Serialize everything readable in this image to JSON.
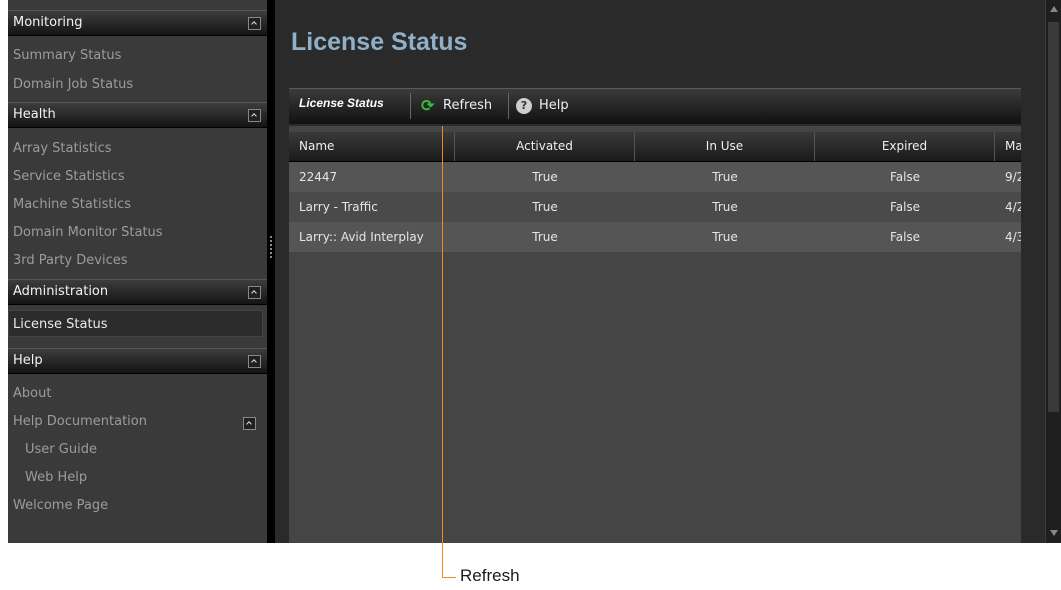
{
  "sidebar": {
    "sections": [
      {
        "title": "Monitoring",
        "items": [
          "Summary Status",
          "Domain Job Status"
        ]
      },
      {
        "title": "Health",
        "items": [
          "Array Statistics",
          "Service Statistics",
          "Machine Statistics",
          "Domain Monitor Status",
          "3rd Party Devices"
        ]
      },
      {
        "title": "Administration",
        "items": [
          "License Status"
        ]
      },
      {
        "title": "Help",
        "items": [
          "About",
          "Help Documentation",
          "User Guide",
          "Web Help",
          "Welcome Page"
        ]
      }
    ],
    "selected": "License Status"
  },
  "main": {
    "title": "License Status",
    "toolbar": {
      "tab": "License Status",
      "refresh": "Refresh",
      "help": "Help"
    },
    "table": {
      "columns": [
        "Name",
        "Activated",
        "In Use",
        "Expired",
        "Ma"
      ],
      "rows": [
        [
          "22447",
          "True",
          "True",
          "False",
          "9/2"
        ],
        [
          "Larry - Traffic",
          "True",
          "True",
          "False",
          "4/2"
        ],
        [
          "Larry:: Avid Interplay",
          "True",
          "True",
          "False",
          "4/3"
        ]
      ]
    }
  },
  "callout": {
    "label": "Refresh"
  },
  "icons": {
    "refresh": "refresh-icon",
    "help": "help-icon",
    "collapse": "chevron-up-icon"
  },
  "colors": {
    "title": "#8fb0c6",
    "callout": "#f18a21",
    "refresh_icon": "#35c23a"
  }
}
